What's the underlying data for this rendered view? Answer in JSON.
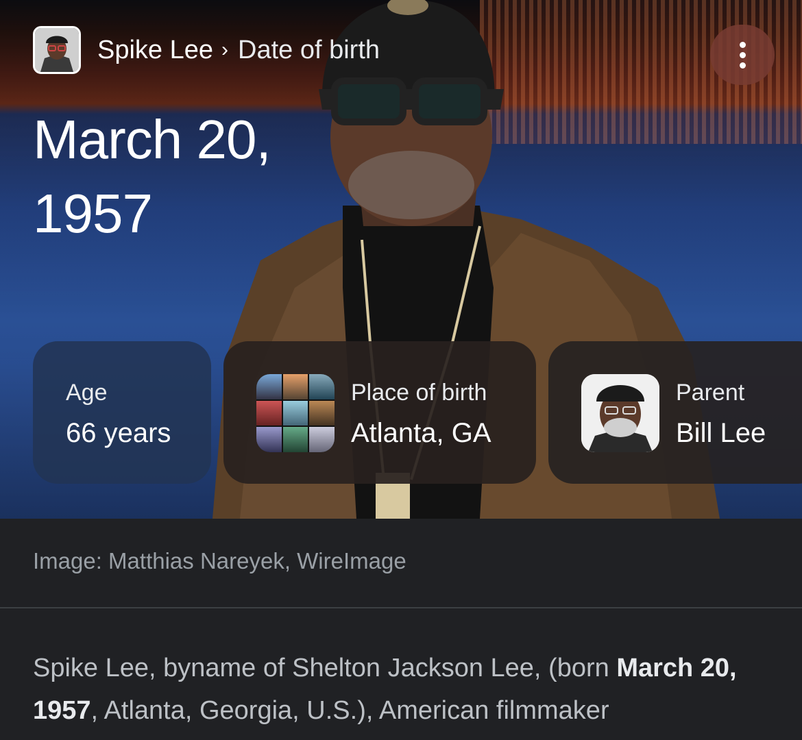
{
  "header": {
    "entity": "Spike Lee",
    "separator": "›",
    "attribute": "Date of birth"
  },
  "main_answer": "March 20, 1957",
  "cards": [
    {
      "label": "Age",
      "value": "66 years"
    },
    {
      "label": "Place of birth",
      "value": "Atlanta, GA"
    },
    {
      "label": "Parent",
      "value": "Bill Lee"
    }
  ],
  "image_credit": "Image: Matthias Nareyek, WireImage",
  "description": {
    "pre": "Spike Lee, byname of Shelton Jackson Lee, (born ",
    "bold": "March 20, 1957",
    "post": ", Atlanta, Georgia, U.S.), American filmmaker"
  },
  "icons": {
    "menu": "more-vert-icon"
  }
}
